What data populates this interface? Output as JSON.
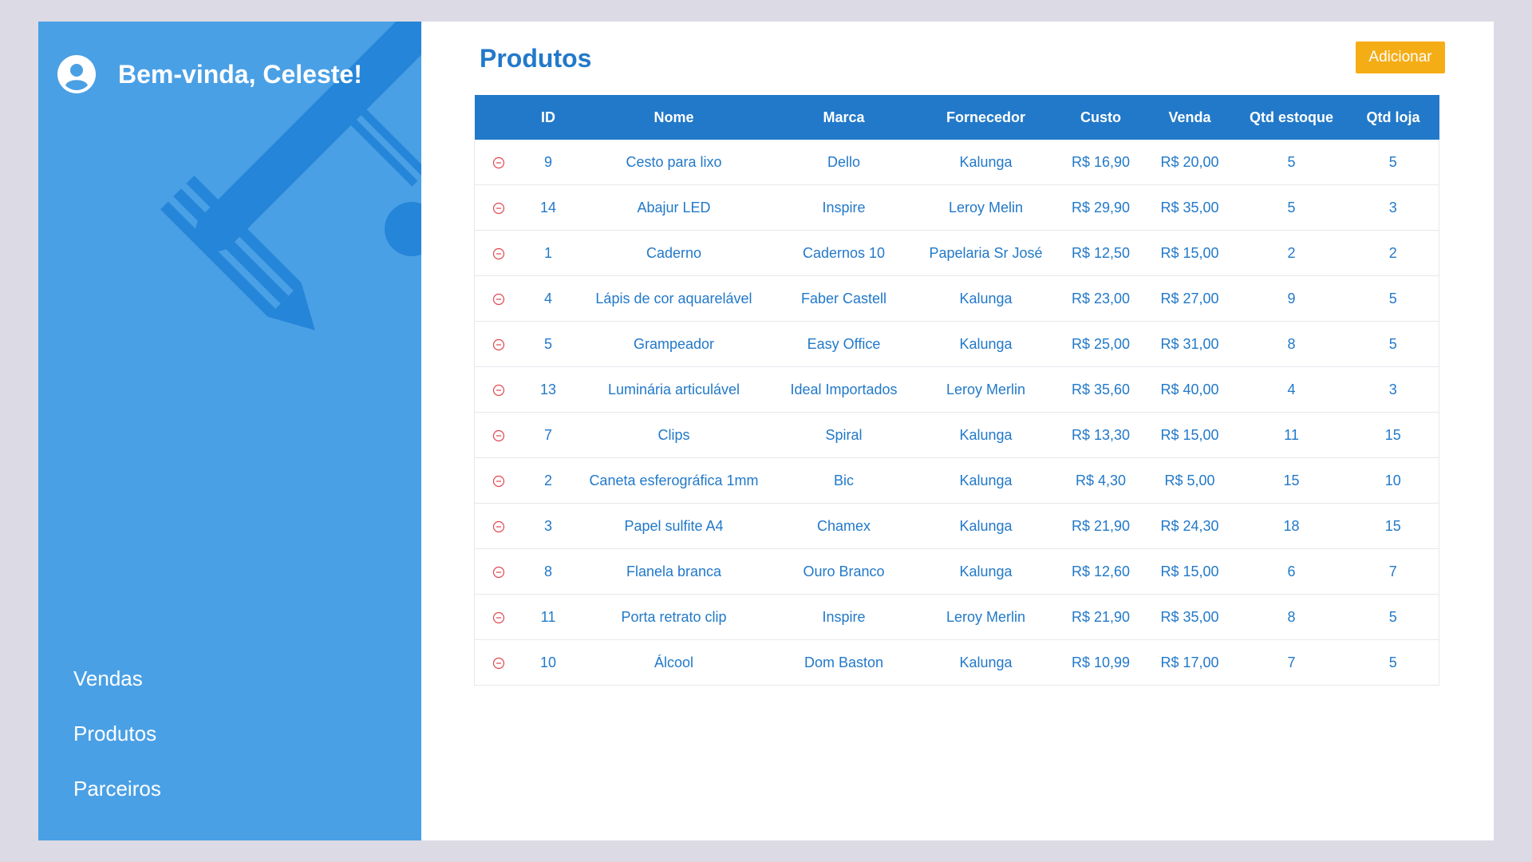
{
  "sidebar": {
    "avatar_icon": "user-circle-icon",
    "decoration_icon": "pencil-icon",
    "greeting": "Bem-vinda, Celeste!",
    "nav": [
      {
        "label": "Vendas",
        "name": "sidebar-item-vendas"
      },
      {
        "label": "Produtos",
        "name": "sidebar-item-produtos"
      },
      {
        "label": "Parceiros",
        "name": "sidebar-item-parceiros"
      }
    ]
  },
  "main": {
    "title": "Produtos",
    "add_label": "Adicionar",
    "table": {
      "columns": [
        "",
        "ID",
        "Nome",
        "Marca",
        "Fornecedor",
        "Custo",
        "Venda",
        "Qtd estoque",
        "Qtd loja"
      ],
      "row_action_icon": "minus-circle-icon",
      "rows": [
        [
          "9",
          "Cesto para lixo",
          "Dello",
          "Kalunga",
          "R$ 16,90",
          "R$ 20,00",
          "5",
          "5"
        ],
        [
          "14",
          "Abajur LED",
          "Inspire",
          "Leroy Melin",
          "R$ 29,90",
          "R$ 35,00",
          "5",
          "3"
        ],
        [
          "1",
          "Caderno",
          "Cadernos 10",
          "Papelaria Sr José",
          "R$ 12,50",
          "R$ 15,00",
          "2",
          "2"
        ],
        [
          "4",
          "Lápis de cor aquarelável",
          "Faber Castell",
          "Kalunga",
          "R$ 23,00",
          "R$ 27,00",
          "9",
          "5"
        ],
        [
          "5",
          "Grampeador",
          "Easy Office",
          "Kalunga",
          "R$ 25,00",
          "R$ 31,00",
          "8",
          "5"
        ],
        [
          "13",
          "Luminária articulável",
          "Ideal Importados",
          "Leroy Merlin",
          "R$ 35,60",
          "R$ 40,00",
          "4",
          "3"
        ],
        [
          "7",
          "Clips",
          "Spiral",
          "Kalunga",
          "R$ 13,30",
          "R$ 15,00",
          "11",
          "15"
        ],
        [
          "2",
          "Caneta esferográfica 1mm",
          "Bic",
          "Kalunga",
          "R$ 4,30",
          "R$ 5,00",
          "15",
          "10"
        ],
        [
          "3",
          "Papel sulfite A4",
          "Chamex",
          "Kalunga",
          "R$ 21,90",
          "R$ 24,30",
          "18",
          "15"
        ],
        [
          "8",
          "Flanela branca",
          "Ouro Branco",
          "Kalunga",
          "R$ 12,60",
          "R$ 15,00",
          "6",
          "7"
        ],
        [
          "11",
          "Porta retrato clip",
          "Inspire",
          "Leroy Merlin",
          "R$ 21,90",
          "R$ 35,00",
          "8",
          "5"
        ],
        [
          "10",
          "Álcool",
          "Dom Baston",
          "Kalunga",
          "R$ 10,99",
          "R$ 17,00",
          "7",
          "5"
        ]
      ]
    }
  },
  "colors": {
    "sidebar_bg": "#4aa0e5",
    "primary": "#2279c9",
    "accent": "#f5ad16",
    "danger": "#e0464f",
    "page_bg": "#dcdae4"
  }
}
